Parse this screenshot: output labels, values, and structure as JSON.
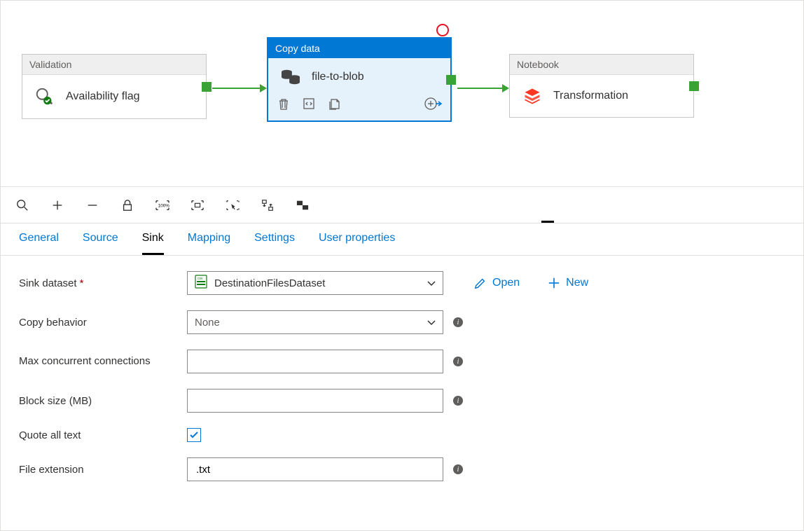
{
  "pipeline": {
    "activities": {
      "validation": {
        "type": "Validation",
        "label": "Availability flag"
      },
      "copy": {
        "type": "Copy data",
        "label": "file-to-blob"
      },
      "notebook": {
        "type": "Notebook",
        "label": "Transformation"
      }
    }
  },
  "tabs": {
    "general": "General",
    "source": "Source",
    "sink": "Sink",
    "mapping": "Mapping",
    "settings": "Settings",
    "user_props": "User properties"
  },
  "buttons": {
    "open": "Open",
    "new": "New"
  },
  "sink_form": {
    "dataset_label": "Sink dataset",
    "dataset_value": "DestinationFilesDataset",
    "copy_behavior_label": "Copy behavior",
    "copy_behavior_value": "None",
    "max_conn_label": "Max concurrent connections",
    "max_conn_value": "",
    "block_size_label": "Block size (MB)",
    "block_size_value": "",
    "quote_all_label": "Quote all text",
    "quote_all_checked": true,
    "file_ext_label": "File extension",
    "file_ext_value": ".txt"
  }
}
